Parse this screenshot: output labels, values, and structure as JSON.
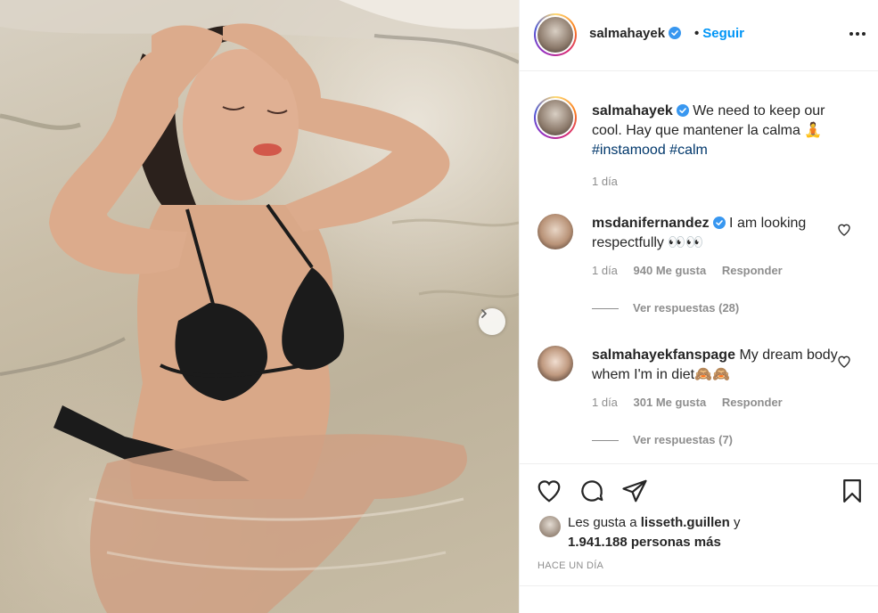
{
  "post": {
    "username": "salmahayek",
    "follow_label": "Seguir",
    "follow_separator": "•",
    "caption_text": "We need to keep our cool. Hay que mantener la calma 🧘",
    "hashtags": [
      "#instamood",
      "#calm"
    ],
    "caption_time": "1 día"
  },
  "comments": [
    {
      "username": "msdanifernandez",
      "verified": true,
      "text": "I am looking respectfully 👀👀",
      "time": "1 día",
      "likes": "940 Me gusta",
      "reply_label": "Responder",
      "view_replies": "Ver respuestas (28)"
    },
    {
      "username": "salmahayekfanspage",
      "verified": false,
      "text": "My dream body whem I'm in diet🙈🙈",
      "time": "1 día",
      "likes": "301 Me gusta",
      "reply_label": "Responder",
      "view_replies": "Ver respuestas (7)"
    }
  ],
  "likes": {
    "prefix": "Les gusta a",
    "user": "lisseth.guillen",
    "and": "y",
    "count": "1.941.188 personas más"
  },
  "post_time": "HACE UN DÍA",
  "icons": {
    "verified": "verified-badge-icon",
    "more": "more-horizontal-icon",
    "heart": "heart-icon",
    "comment": "comment-icon",
    "share": "share-icon",
    "save": "bookmark-icon",
    "carousel": "chevron-right-icon"
  },
  "colors": {
    "link_blue": "#0095f6",
    "hashtag": "#00376b",
    "secondary": "#8e8e8e",
    "verified": "#3897f0"
  }
}
